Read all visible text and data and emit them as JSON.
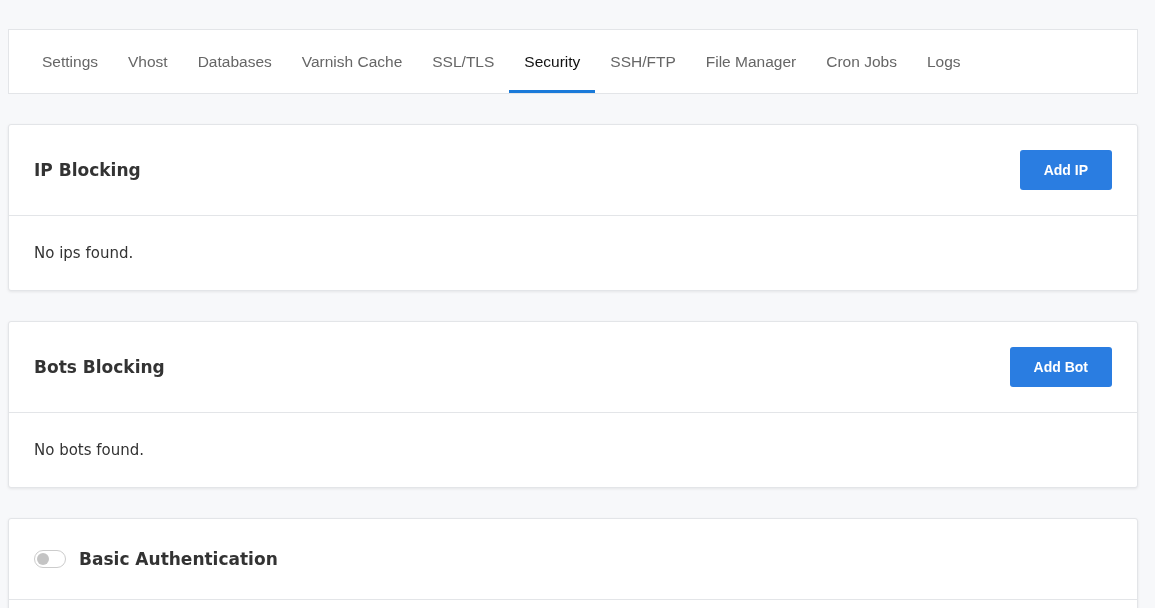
{
  "tabs": [
    {
      "label": "Settings",
      "selected": false
    },
    {
      "label": "Vhost",
      "selected": false
    },
    {
      "label": "Databases",
      "selected": false
    },
    {
      "label": "Varnish Cache",
      "selected": false
    },
    {
      "label": "SSL/TLS",
      "selected": false
    },
    {
      "label": "Security",
      "selected": true
    },
    {
      "label": "SSH/FTP",
      "selected": false
    },
    {
      "label": "File Manager",
      "selected": false
    },
    {
      "label": "Cron Jobs",
      "selected": false
    },
    {
      "label": "Logs",
      "selected": false
    }
  ],
  "ip_blocking": {
    "title": "IP Blocking",
    "button": "Add IP",
    "empty_message": "No ips found."
  },
  "bots_blocking": {
    "title": "Bots Blocking",
    "button": "Add Bot",
    "empty_message": "No bots found."
  },
  "basic_authentication": {
    "title": "Basic Authentication",
    "on": false
  }
}
